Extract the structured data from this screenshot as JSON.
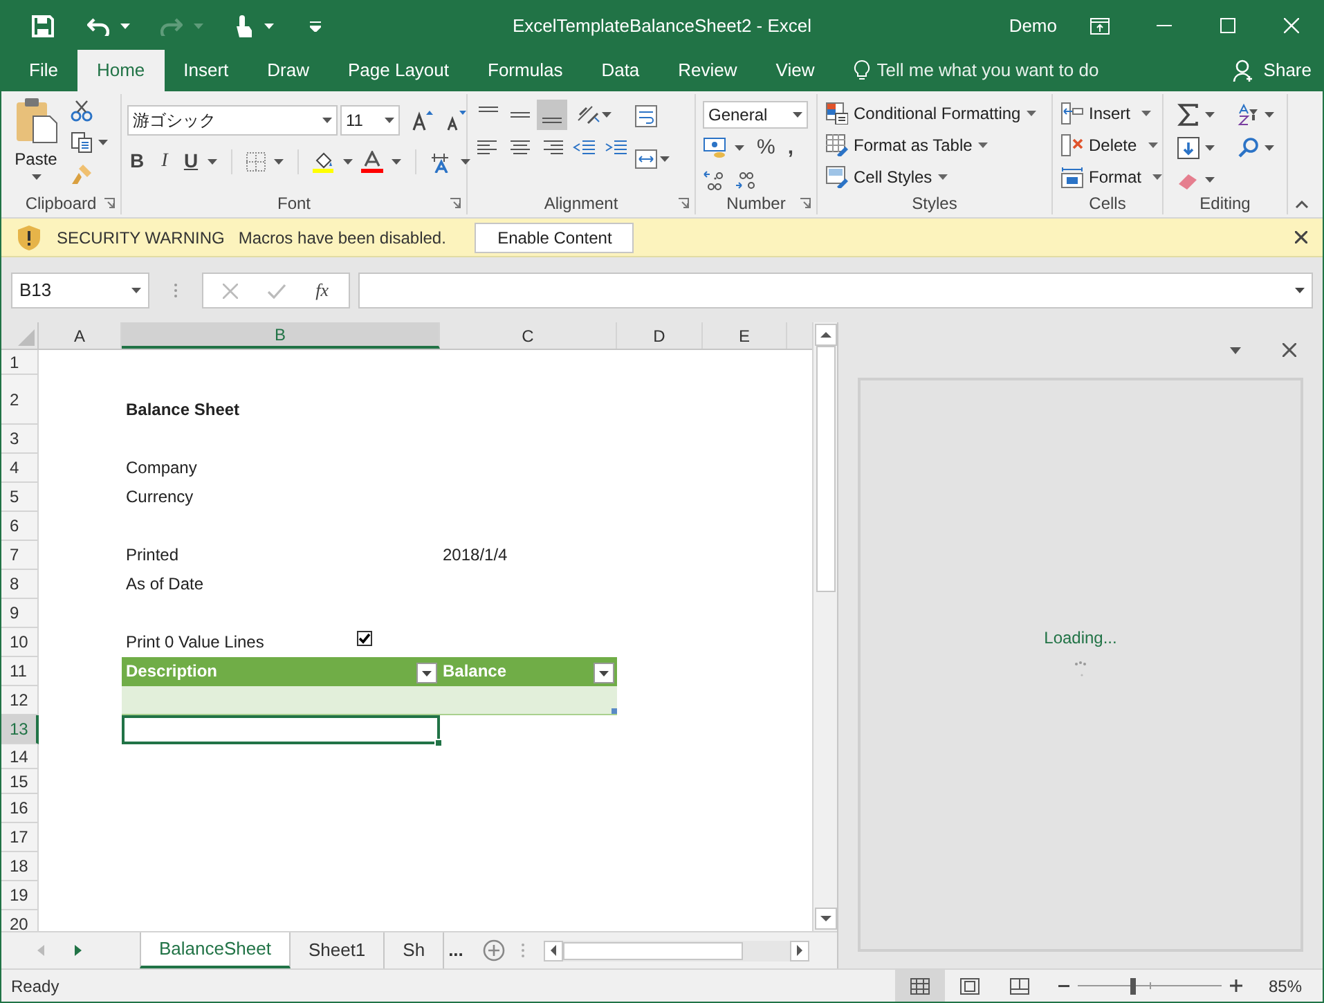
{
  "title_bar": {
    "title": "ExcelTemplateBalanceSheet2  -  Excel",
    "user": "Demo"
  },
  "ribbon_tabs": [
    {
      "label": "File",
      "selected": false
    },
    {
      "label": "Home",
      "selected": true
    },
    {
      "label": "Insert",
      "selected": false
    },
    {
      "label": "Draw",
      "selected": false
    },
    {
      "label": "Page Layout",
      "selected": false
    },
    {
      "label": "Formulas",
      "selected": false
    },
    {
      "label": "Data",
      "selected": false
    },
    {
      "label": "Review",
      "selected": false
    },
    {
      "label": "View",
      "selected": false
    }
  ],
  "tell_me": "Tell me what you want to do",
  "share": "Share",
  "ribbon": {
    "clipboard": {
      "paste": "Paste",
      "label": "Clipboard"
    },
    "font": {
      "font_name": "游ゴシック",
      "font_size": "11",
      "bold": "B",
      "italic": "I",
      "underline": "U",
      "label": "Font"
    },
    "alignment": {
      "vertical_align_buttons": [
        {
          "selected": false
        },
        {
          "selected": false
        },
        {
          "selected": true
        }
      ],
      "label": "Alignment"
    },
    "number": {
      "format": "General",
      "percent": "%",
      "comma": ",",
      "label": "Number"
    },
    "styles": {
      "buttons": [
        "Conditional Formatting",
        "Format as Table",
        "Cell Styles"
      ],
      "label": "Styles"
    },
    "cells": {
      "buttons": [
        "Insert",
        "Delete",
        "Format"
      ],
      "label": "Cells"
    },
    "editing": {
      "label": "Editing"
    }
  },
  "security_bar": {
    "title": "SECURITY WARNING",
    "message": "Macros have been disabled.",
    "button": "Enable Content"
  },
  "formula_bar": {
    "name_box": "B13",
    "function_button": "fx"
  },
  "sheet": {
    "columns": [
      {
        "label": "A",
        "selected": false
      },
      {
        "label": "B",
        "selected": true
      },
      {
        "label": "C",
        "selected": false
      },
      {
        "label": "D",
        "selected": false
      },
      {
        "label": "E",
        "selected": false
      }
    ],
    "rows": [
      {
        "label": "1",
        "selected": false,
        "kind": "empty"
      },
      {
        "label": "2",
        "selected": false,
        "kind": "title",
        "b": "Balance Sheet"
      },
      {
        "label": "3",
        "selected": false,
        "kind": "empty"
      },
      {
        "label": "4",
        "selected": false,
        "kind": "text",
        "b": "Company"
      },
      {
        "label": "5",
        "selected": false,
        "kind": "text",
        "b": "Currency"
      },
      {
        "label": "6",
        "selected": false,
        "kind": "empty"
      },
      {
        "label": "7",
        "selected": false,
        "kind": "text",
        "b": "Printed",
        "c": "2018/1/4"
      },
      {
        "label": "8",
        "selected": false,
        "kind": "text",
        "b": "As of Date"
      },
      {
        "label": "9",
        "selected": false,
        "kind": "empty"
      },
      {
        "label": "10",
        "selected": false,
        "kind": "checkbox",
        "b": "Print 0 Value Lines",
        "checked": true
      },
      {
        "label": "11",
        "selected": false,
        "kind": "table_header",
        "b": "Description",
        "c": "Balance"
      },
      {
        "label": "12",
        "selected": false,
        "kind": "table_row"
      },
      {
        "label": "13",
        "selected": true,
        "kind": "active_cell"
      },
      {
        "label": "14",
        "selected": false,
        "kind": "empty"
      },
      {
        "label": "15",
        "selected": false,
        "kind": "empty"
      },
      {
        "label": "16",
        "selected": false,
        "kind": "empty"
      },
      {
        "label": "17",
        "selected": false,
        "kind": "empty"
      },
      {
        "label": "18",
        "selected": false,
        "kind": "empty"
      },
      {
        "label": "19",
        "selected": false,
        "kind": "empty"
      },
      {
        "label": "20",
        "selected": false,
        "kind": "empty"
      }
    ]
  },
  "task_pane": {
    "status": "Loading..."
  },
  "sheet_tabs": [
    {
      "label": "BalanceSheet",
      "selected": true
    },
    {
      "label": "Sheet1",
      "selected": false
    },
    {
      "label": "Sh",
      "selected": false
    }
  ],
  "more_tabs": "...",
  "status_bar": {
    "status": "Ready",
    "views": [
      {
        "selected": true
      },
      {
        "selected": false
      },
      {
        "selected": false
      }
    ],
    "zoom": {
      "level": 0.37,
      "reading": "85%"
    }
  }
}
